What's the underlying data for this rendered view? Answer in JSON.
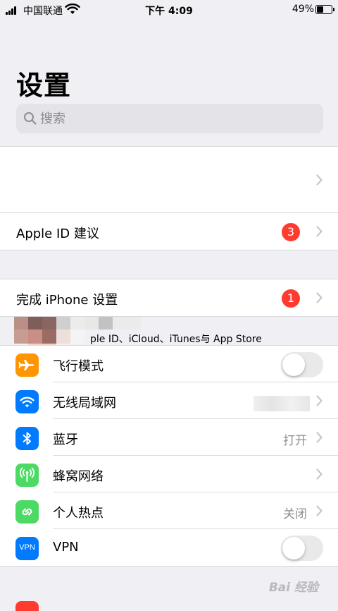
{
  "status_bar": {
    "carrier": "中国联通",
    "time": "下午 4:09",
    "battery_percent": "49%",
    "battery_level": 0.49
  },
  "page_title": "设置",
  "search": {
    "placeholder": "搜索"
  },
  "profile": {
    "subtitle": "ple ID、iCloud、iTunes与 App Store"
  },
  "suggestions": [
    {
      "label": "Apple ID 建议",
      "badge": "3"
    }
  ],
  "finish_setup": {
    "label": "完成 iPhone 设置",
    "badge": "1"
  },
  "settings": [
    {
      "label": "飞行模式",
      "icon": "airplane-icon",
      "color": "#ff9500",
      "control": "toggle",
      "on": false
    },
    {
      "label": "无线局域网",
      "icon": "wifi-icon",
      "color": "#007aff",
      "control": "chevron"
    },
    {
      "label": "蓝牙",
      "icon": "bluetooth-icon",
      "color": "#007aff",
      "value": "打开",
      "control": "chevron"
    },
    {
      "label": "蜂窝网络",
      "icon": "antenna-icon",
      "color": "#4cd964",
      "control": "chevron"
    },
    {
      "label": "个人热点",
      "icon": "hotspot-icon",
      "color": "#4cd964",
      "value": "关闭",
      "control": "chevron"
    },
    {
      "label": "VPN",
      "icon": "vpn-icon",
      "icon_text": "VPN",
      "color": "#007aff",
      "control": "toggle",
      "on": false
    }
  ],
  "watermark": "Bai 经验"
}
